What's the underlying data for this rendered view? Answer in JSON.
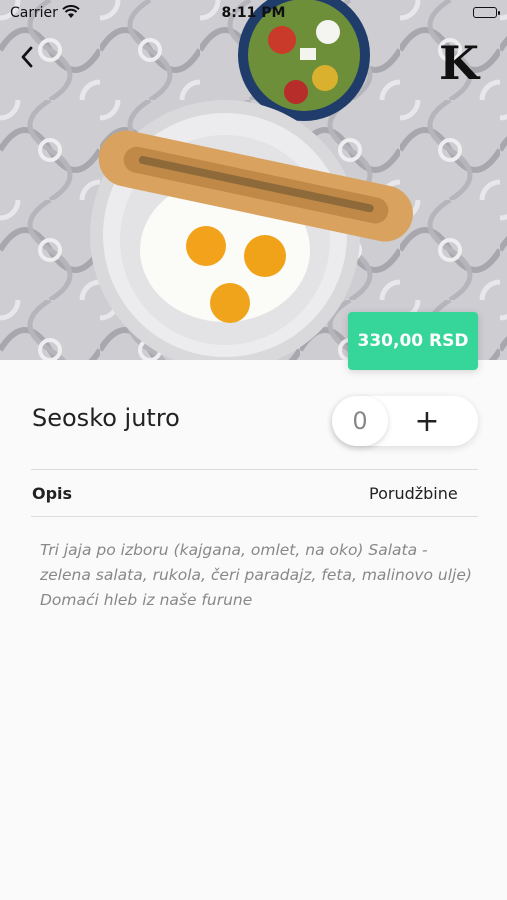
{
  "status_bar": {
    "carrier": "Carrier",
    "time": "8:11 PM"
  },
  "header": {
    "logo": "K"
  },
  "product": {
    "price": "330,00 RSD",
    "name": "Seosko jutro",
    "quantity": "0",
    "add_label": "+"
  },
  "tabs": {
    "description": "Opis",
    "orders": "Porudžbine"
  },
  "description_text": "Tri jaja po izboru (kajgana, omlet, na oko) Salata - zelena salata, rukola, čeri paradajz, feta, malinovo ulje) Domaći hleb iz naše furune",
  "colors": {
    "accent": "#36d69a"
  }
}
